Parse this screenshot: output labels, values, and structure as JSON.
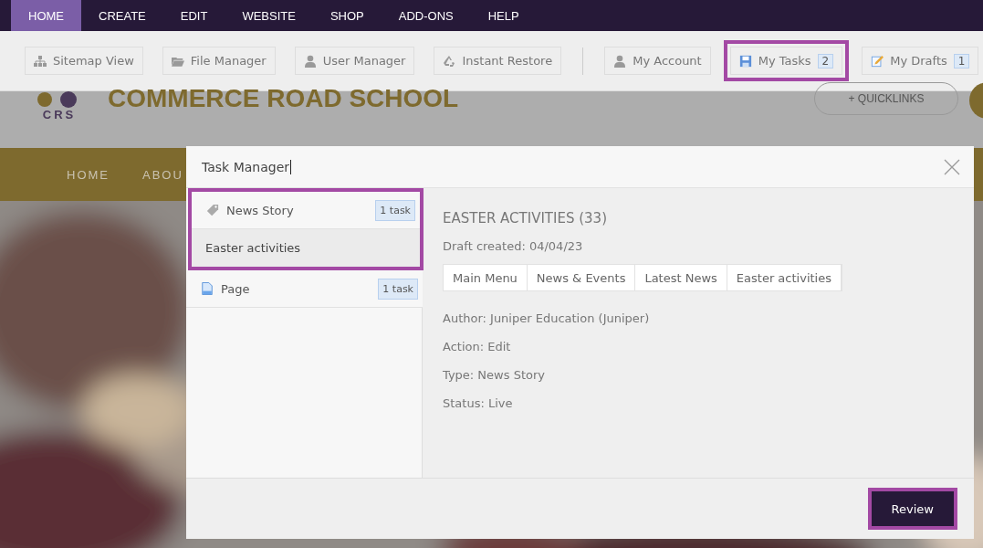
{
  "menu": [
    {
      "label": "HOME",
      "selected": true
    },
    {
      "label": "CREATE",
      "selected": false
    },
    {
      "label": "EDIT",
      "selected": false
    },
    {
      "label": "WEBSITE",
      "selected": false
    },
    {
      "label": "SHOP",
      "selected": false
    },
    {
      "label": "ADD-ONS",
      "selected": false
    },
    {
      "label": "HELP",
      "selected": false
    }
  ],
  "toolbar": {
    "left": [
      {
        "label": "Sitemap View",
        "kind": "sitemap",
        "highlighted": false
      },
      {
        "label": "File Manager",
        "kind": "folder",
        "highlighted": false
      },
      {
        "label": "User Manager",
        "kind": "user",
        "highlighted": false
      },
      {
        "label": "Instant Restore",
        "kind": "recycle",
        "highlighted": false
      }
    ],
    "right": [
      {
        "label": "My Account",
        "kind": "user",
        "highlighted": false
      },
      {
        "label": "My Tasks",
        "kind": "save",
        "badge": "2",
        "highlighted": true
      },
      {
        "label": "My Drafts",
        "kind": "pencil",
        "badge": "1",
        "highlighted": false
      }
    ]
  },
  "site": {
    "logo_text": "CRS",
    "title": "COMMERCE ROAD SCHOOL",
    "quicklinks": "+ QUICKLINKS",
    "nav": [
      "HOME",
      "ABOU"
    ]
  },
  "dialog": {
    "title": "Task Manager",
    "groups": [
      {
        "label": "News Story",
        "kind": "tag",
        "badge": "1 task",
        "highlighted": true,
        "items": [
          {
            "label": "Easter activities",
            "selected": true
          }
        ]
      },
      {
        "label": "Page",
        "kind": "page",
        "badge": "1 task",
        "highlighted": false
      }
    ],
    "detail": {
      "heading": "EASTER ACTIVITIES (33)",
      "created": "Draft created: 04/04/23",
      "breadcrumb": [
        "Main Menu",
        "News & Events",
        "Latest News",
        "Easter activities"
      ],
      "fields": [
        "Author: Juniper Education (Juniper)",
        "Action: Edit",
        "Type: News Story",
        "Status: Live"
      ]
    },
    "review": {
      "label": "Review",
      "highlighted": true
    }
  }
}
